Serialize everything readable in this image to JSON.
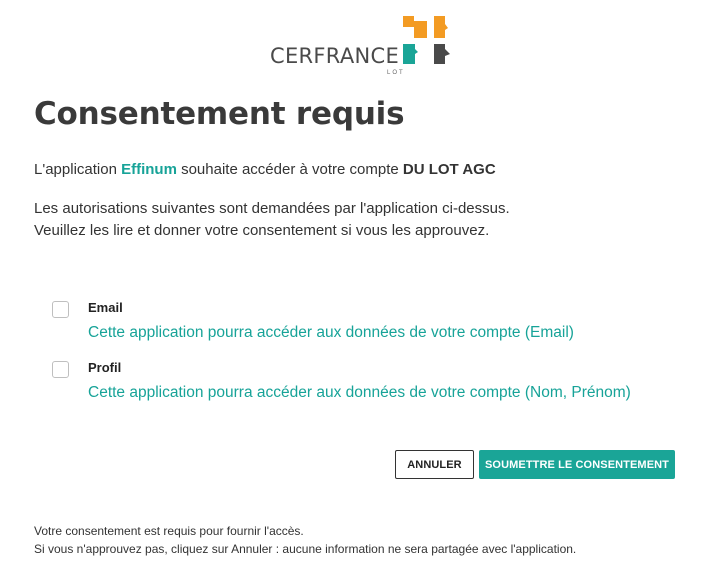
{
  "logo": {
    "brand": "CERFRANCE",
    "sub": "LOT",
    "colors": {
      "orange": "#f39b23",
      "teal": "#1aa597",
      "grey": "#4a4a4a"
    }
  },
  "title": "Consentement requis",
  "intro": {
    "prefix": "L'application ",
    "app_name": "Effinum",
    "middle": " souhaite accéder à votre compte ",
    "account": "DU LOT AGC"
  },
  "description": {
    "line1": "Les autorisations suivantes sont demandées par l'application ci-dessus.",
    "line2": "Veuillez les lire et donner votre consentement si vous les approuvez."
  },
  "permissions": [
    {
      "title": "Email",
      "description": "Cette application pourra accéder aux données de votre compte (Email)",
      "checked": false
    },
    {
      "title": "Profil",
      "description": "Cette application pourra accéder aux données de votre compte (Nom, Prénom)",
      "checked": false
    }
  ],
  "buttons": {
    "cancel": "ANNULER",
    "submit": "SOUMETTRE LE CONSENTEMENT"
  },
  "footer": {
    "line1": "Votre consentement est requis pour fournir l'accès.",
    "line2": "Si vous n'approuvez pas, cliquez sur Annuler : aucune information ne sera partagée avec l'application."
  },
  "accent_color": "#1aa597"
}
